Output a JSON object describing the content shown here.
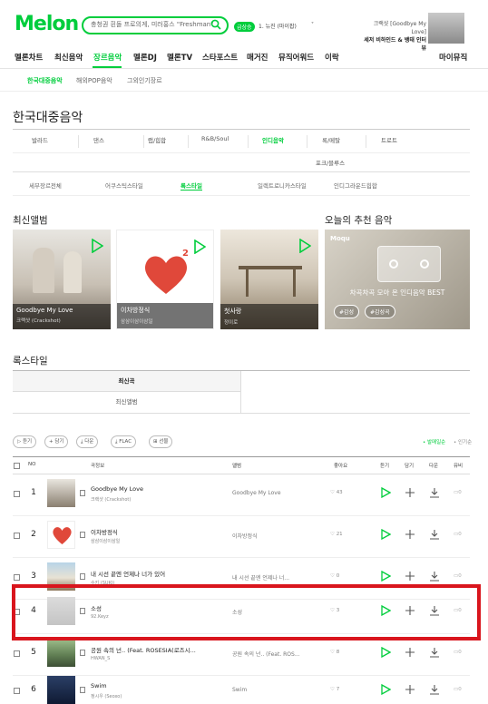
{
  "header": {
    "logo": "Melon",
    "search_placeholder": "충청권 흰돌 프로의게, 미러홍스 \"Freshman\"",
    "badge": "급상승",
    "small1": "1. 뉴진 (마이팝)",
    "promo_line1": "크랙샷 [Goodbye My Love]",
    "promo_line2": "세저 비하인드 & 뱅태 인터뷰"
  },
  "gnb": [
    "멜론차트",
    "최신음악",
    "장르음악",
    "멜론DJ",
    "멜론TV",
    "스타포스트",
    "매거진",
    "뮤직어워드",
    "이락",
    "마이뮤직"
  ],
  "subnav": [
    "한국대중음악",
    "해외POP음악",
    "그외인기장르"
  ],
  "page_title": "한국대중음악",
  "genres_row1": [
    "발라드",
    "댄스",
    "랩/힙합",
    "R&B/Soul",
    "인디음악",
    "록/메탈",
    "트로트"
  ],
  "genres_row2": [
    "포크/블루스"
  ],
  "style_tabs": [
    "세부장르전체",
    "어쿠스틱스타일",
    "록스타일",
    "일렉트로니카스타일",
    "인디그라운드힙합"
  ],
  "latest_title": "최신앨범",
  "albums": [
    {
      "title": "Goodbye My Love",
      "artist": "크랙샷 (Crackshot)"
    },
    {
      "title": "이차방정식",
      "artist": "삼삼이삼이삼일"
    },
    {
      "title": "첫사랑",
      "artist": "정이로"
    }
  ],
  "recommend": {
    "section": "오늘의 추천 음악",
    "brand": "Moqu",
    "title": "차곡차곡 모아 온 인디음악 BEST",
    "tags": [
      "#감성",
      "#감성곡"
    ]
  },
  "rock_style": {
    "title": "록스타일",
    "tab_new_songs": "최신곡",
    "tab_new_albums": "최신앨범"
  },
  "toolbar": {
    "listen": "듣기",
    "add": "담기",
    "download": "다운",
    "flac": "FLAC",
    "gift": "선물",
    "sort_popular": "• 발매일순",
    "sort_recent": "• 인기순"
  },
  "table_headers": {
    "no": "NO",
    "song": "곡정보",
    "album": "앨범",
    "like": "좋아요",
    "listen": "듣기",
    "add": "담기",
    "download": "다운",
    "mv": "뮤비"
  },
  "rows": [
    {
      "rank": "1",
      "song": "Goodbye My Love",
      "artist": "크랙샷 (Crackshot)",
      "album": "Goodbye My Love",
      "likes": "43"
    },
    {
      "rank": "2",
      "song": "이차방정식",
      "artist": "삼삼이삼이삼일",
      "album": "이차방정식",
      "likes": "21"
    },
    {
      "rank": "3",
      "song": "내 시선 끝엔 언제나 너가 있어",
      "artist": "수키 (SUKI)",
      "album": "내 시선 끝엔 언제나 너...",
      "likes": "0"
    },
    {
      "rank": "4",
      "song": "소성",
      "artist": "92.Keyz",
      "album": "소성",
      "likes": "3"
    },
    {
      "rank": "5",
      "song": "공원 속의 넌.. (Feat. ROSESIA(로즈시...",
      "artist": "HWAN_S",
      "album": "공원 속의 넌.. (Feat. ROS...",
      "likes": "8"
    },
    {
      "rank": "6",
      "song": "Swim",
      "artist": "정시우 (Seoxo)",
      "album": "Swim",
      "likes": "7"
    }
  ],
  "colors": {
    "accent": "#00cd3c",
    "highlight": "#d9151d"
  }
}
